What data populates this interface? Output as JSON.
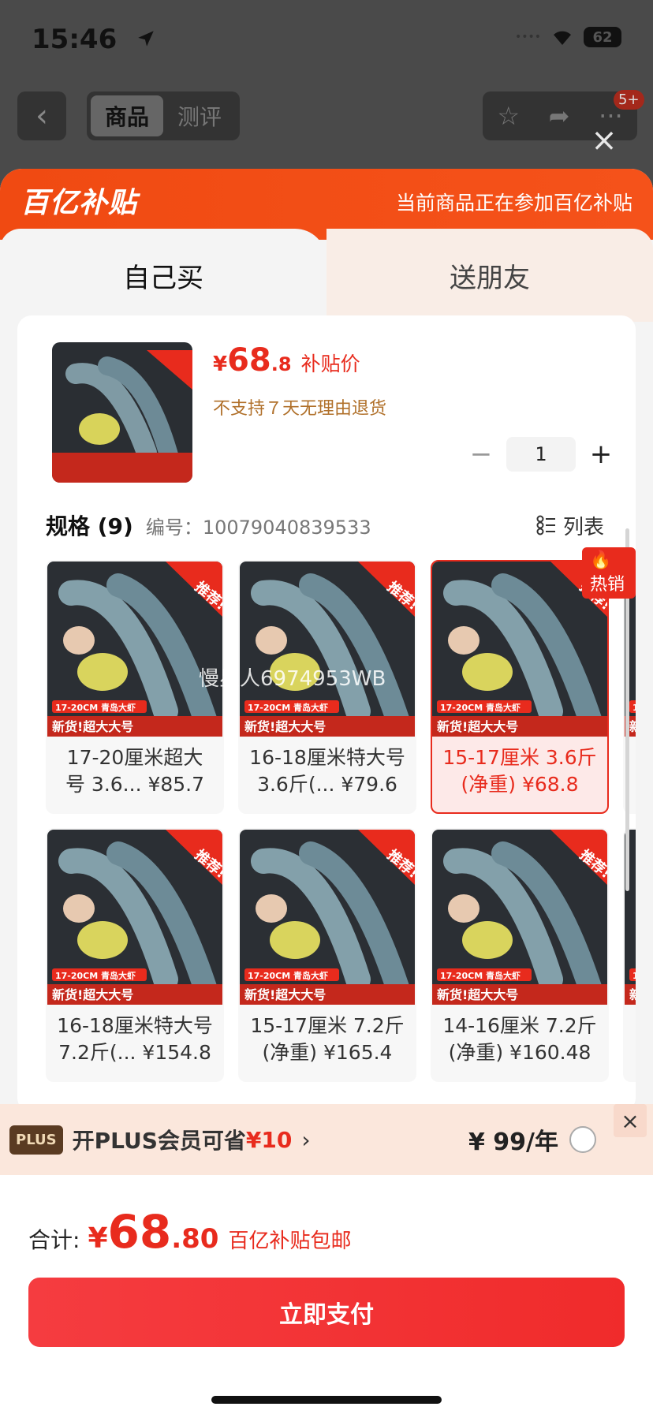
{
  "status": {
    "time": "15:46",
    "battery": "62"
  },
  "header": {
    "tabs": [
      "商品",
      "测评"
    ],
    "badge": "5+"
  },
  "brand": {
    "logo": "百亿补贴",
    "tip": "当前商品正在参加百亿补贴"
  },
  "buy_tabs": [
    "自己买",
    "送朋友"
  ],
  "product": {
    "currency": "¥",
    "price_int": "68",
    "price_dec": ".8",
    "price_label": "补贴价",
    "return_policy": "不支持７天无理由退货",
    "quantity": "1",
    "thumb_tag": "新货!超大大号"
  },
  "spec": {
    "title": "规格 (9)",
    "code": "编号：10079040839533",
    "list_label": "列表",
    "hot_label": "热销",
    "items": [
      {
        "line1": "17-20厘米超大",
        "line2": "号 3.6...  ¥85.7"
      },
      {
        "line1": "16-18厘米特大号",
        "line2": "3.6斤(...  ¥79.6"
      },
      {
        "line1": "15-17厘米 3.6斤",
        "line2": "(净重) ¥68.8"
      },
      {
        "line1": "16-18厘米特大号",
        "line2": "7.2斤(...  ¥154.8"
      },
      {
        "line1": "15-17厘米 7.2斤",
        "line2": "(净重) ¥165.4"
      },
      {
        "line1": "14-16厘米 7.2斤",
        "line2": "(净重) ¥160.48"
      }
    ],
    "selected_index": 2,
    "image_tags": {
      "size": "17-20CM",
      "origin": "青岛大虾",
      "new": "新货!超大大号",
      "rec": "推荐!"
    }
  },
  "watermark": "慢星人6974953WB",
  "plus": {
    "tag": "PLUS",
    "text": "开PLUS会员可省",
    "save": "¥10",
    "arrow": "›",
    "price": "¥ 99/年"
  },
  "total": {
    "label": "合计:",
    "currency": "¥",
    "int": "68",
    "dec": ".80",
    "note": "百亿补贴包邮"
  },
  "pay_button": "立即支付",
  "colors": {
    "accent": "#e82b1d",
    "brand": "#f04a12"
  }
}
